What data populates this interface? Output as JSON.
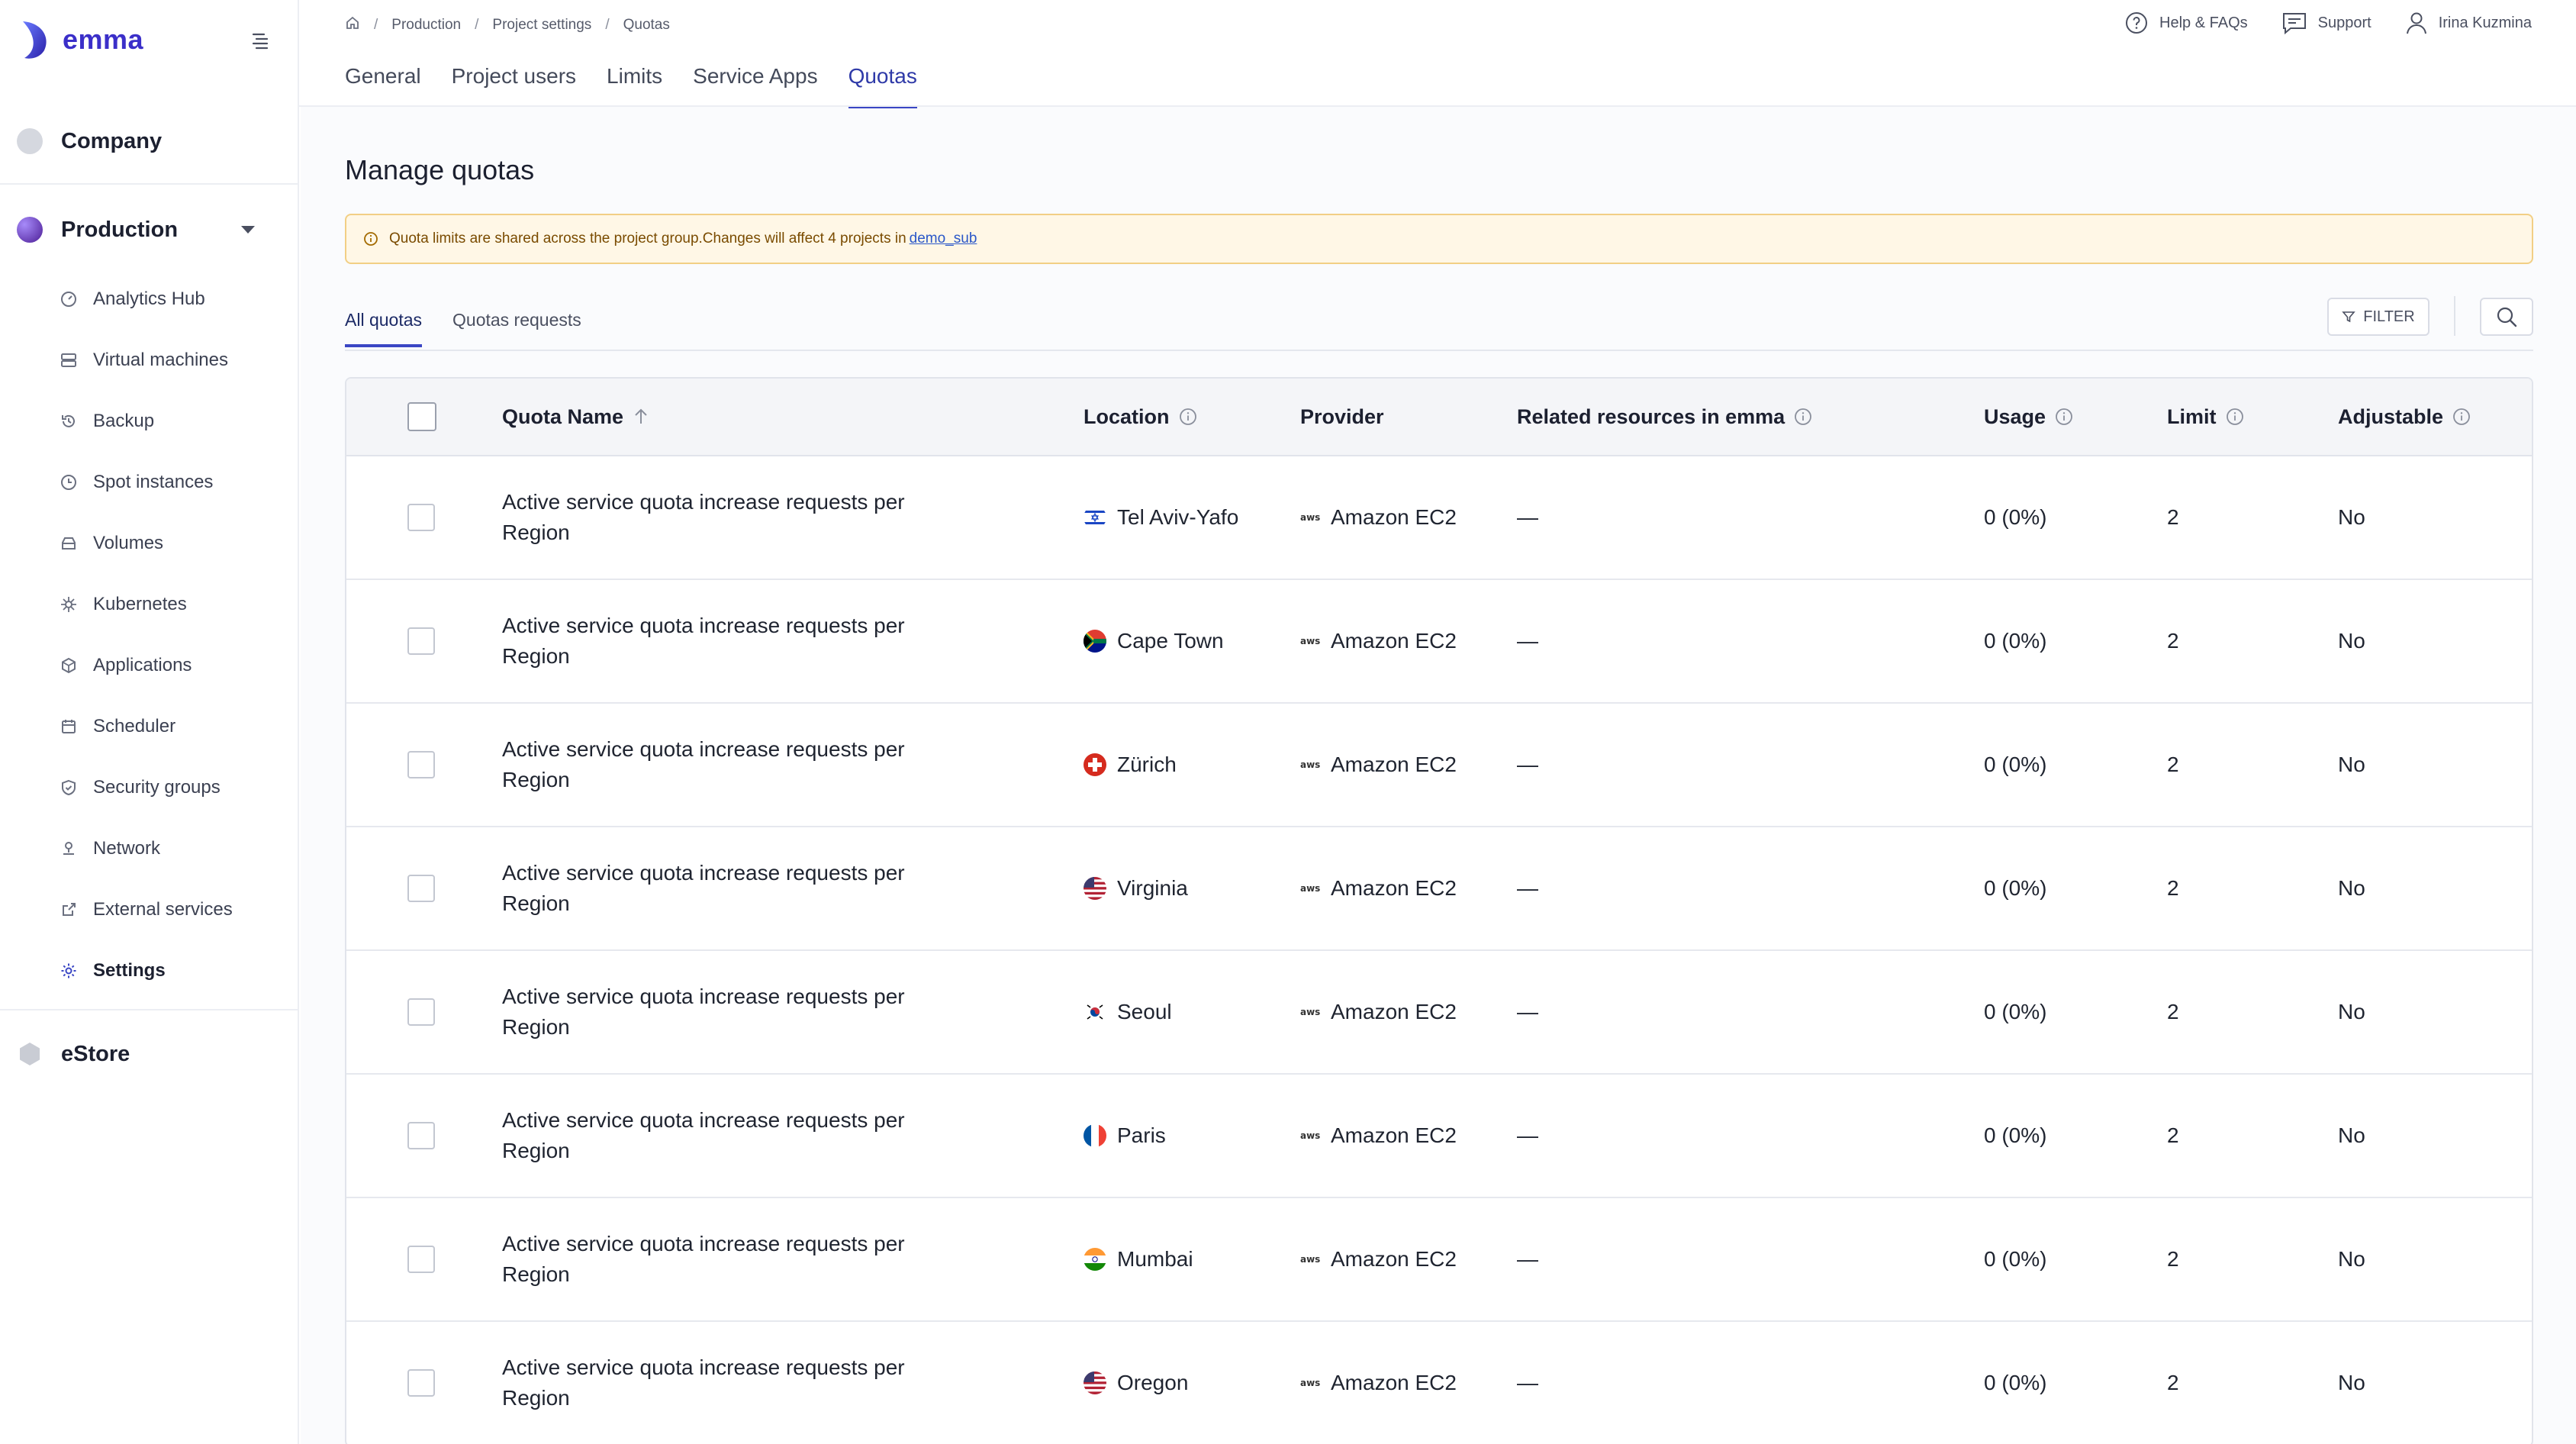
{
  "app": {
    "logo_text": "emma",
    "brand_color": "#3b2fc9"
  },
  "sidebar": {
    "orgs": {
      "company": "Company",
      "production": "Production",
      "estore": "eStore"
    },
    "items": [
      {
        "label": "Analytics Hub",
        "icon": "analytics-icon"
      },
      {
        "label": "Virtual machines",
        "icon": "server-icon"
      },
      {
        "label": "Backup",
        "icon": "backup-icon"
      },
      {
        "label": "Spot instances",
        "icon": "clock-icon"
      },
      {
        "label": "Volumes",
        "icon": "volume-icon"
      },
      {
        "label": "Kubernetes",
        "icon": "kubernetes-icon"
      },
      {
        "label": "Applications",
        "icon": "cube-icon"
      },
      {
        "label": "Scheduler",
        "icon": "calendar-icon"
      },
      {
        "label": "Security groups",
        "icon": "shield-icon"
      },
      {
        "label": "Network",
        "icon": "network-icon"
      },
      {
        "label": "External services",
        "icon": "external-icon"
      },
      {
        "label": "Settings",
        "icon": "gear-icon",
        "active": true
      }
    ]
  },
  "header": {
    "breadcrumb": [
      "Production",
      "Project settings",
      "Quotas"
    ],
    "help": "Help & FAQs",
    "support": "Support",
    "user": "Irina Kuzmina",
    "tabs": [
      "General",
      "Project users",
      "Limits",
      "Service Apps",
      "Quotas"
    ],
    "active_tab": "Quotas"
  },
  "page": {
    "title": "Manage quotas",
    "alert_text": "Quota limits are shared across the project group.Changes will affect 4 projects in",
    "alert_link": "demo_sub",
    "subtabs": [
      "All quotas",
      "Quotas requests"
    ],
    "filter_label": "FILTER"
  },
  "table": {
    "columns": {
      "name": "Quota Name",
      "location": "Location",
      "provider": "Provider",
      "related": "Related resources in emma",
      "usage": "Usage",
      "limit": "Limit",
      "adjustable": "Adjustable"
    },
    "rows": [
      {
        "name": "Active service quota increase requests per Region",
        "location": "Tel Aviv-Yafo",
        "flag": "israel-flag",
        "provider": "Amazon EC2",
        "related": "—",
        "usage": "0 (0%)",
        "limit": "2",
        "adjustable": "No"
      },
      {
        "name": "Active service quota increase requests per Region",
        "location": "Cape Town",
        "flag": "south-africa-flag",
        "provider": "Amazon EC2",
        "related": "—",
        "usage": "0 (0%)",
        "limit": "2",
        "adjustable": "No"
      },
      {
        "name": "Active service quota increase requests per Region",
        "location": "Zürich",
        "flag": "switzerland-flag",
        "provider": "Amazon EC2",
        "related": "—",
        "usage": "0 (0%)",
        "limit": "2",
        "adjustable": "No"
      },
      {
        "name": "Active service quota increase requests per Region",
        "location": "Virginia",
        "flag": "usa-flag",
        "provider": "Amazon EC2",
        "related": "—",
        "usage": "0 (0%)",
        "limit": "2",
        "adjustable": "No"
      },
      {
        "name": "Active service quota increase requests per Region",
        "location": "Seoul",
        "flag": "south-korea-flag",
        "provider": "Amazon EC2",
        "related": "—",
        "usage": "0 (0%)",
        "limit": "2",
        "adjustable": "No"
      },
      {
        "name": "Active service quota increase requests per Region",
        "location": "Paris",
        "flag": "france-flag",
        "provider": "Amazon EC2",
        "related": "—",
        "usage": "0 (0%)",
        "limit": "2",
        "adjustable": "No"
      },
      {
        "name": "Active service quota increase requests per Region",
        "location": "Mumbai",
        "flag": "india-flag",
        "provider": "Amazon EC2",
        "related": "—",
        "usage": "0 (0%)",
        "limit": "2",
        "adjustable": "No"
      },
      {
        "name": "Active service quota increase requests per Region",
        "location": "Oregon",
        "flag": "usa-flag",
        "provider": "Amazon EC2",
        "related": "—",
        "usage": "0 (0%)",
        "limit": "2",
        "adjustable": "No"
      }
    ],
    "provider_logo_text": "aws"
  }
}
